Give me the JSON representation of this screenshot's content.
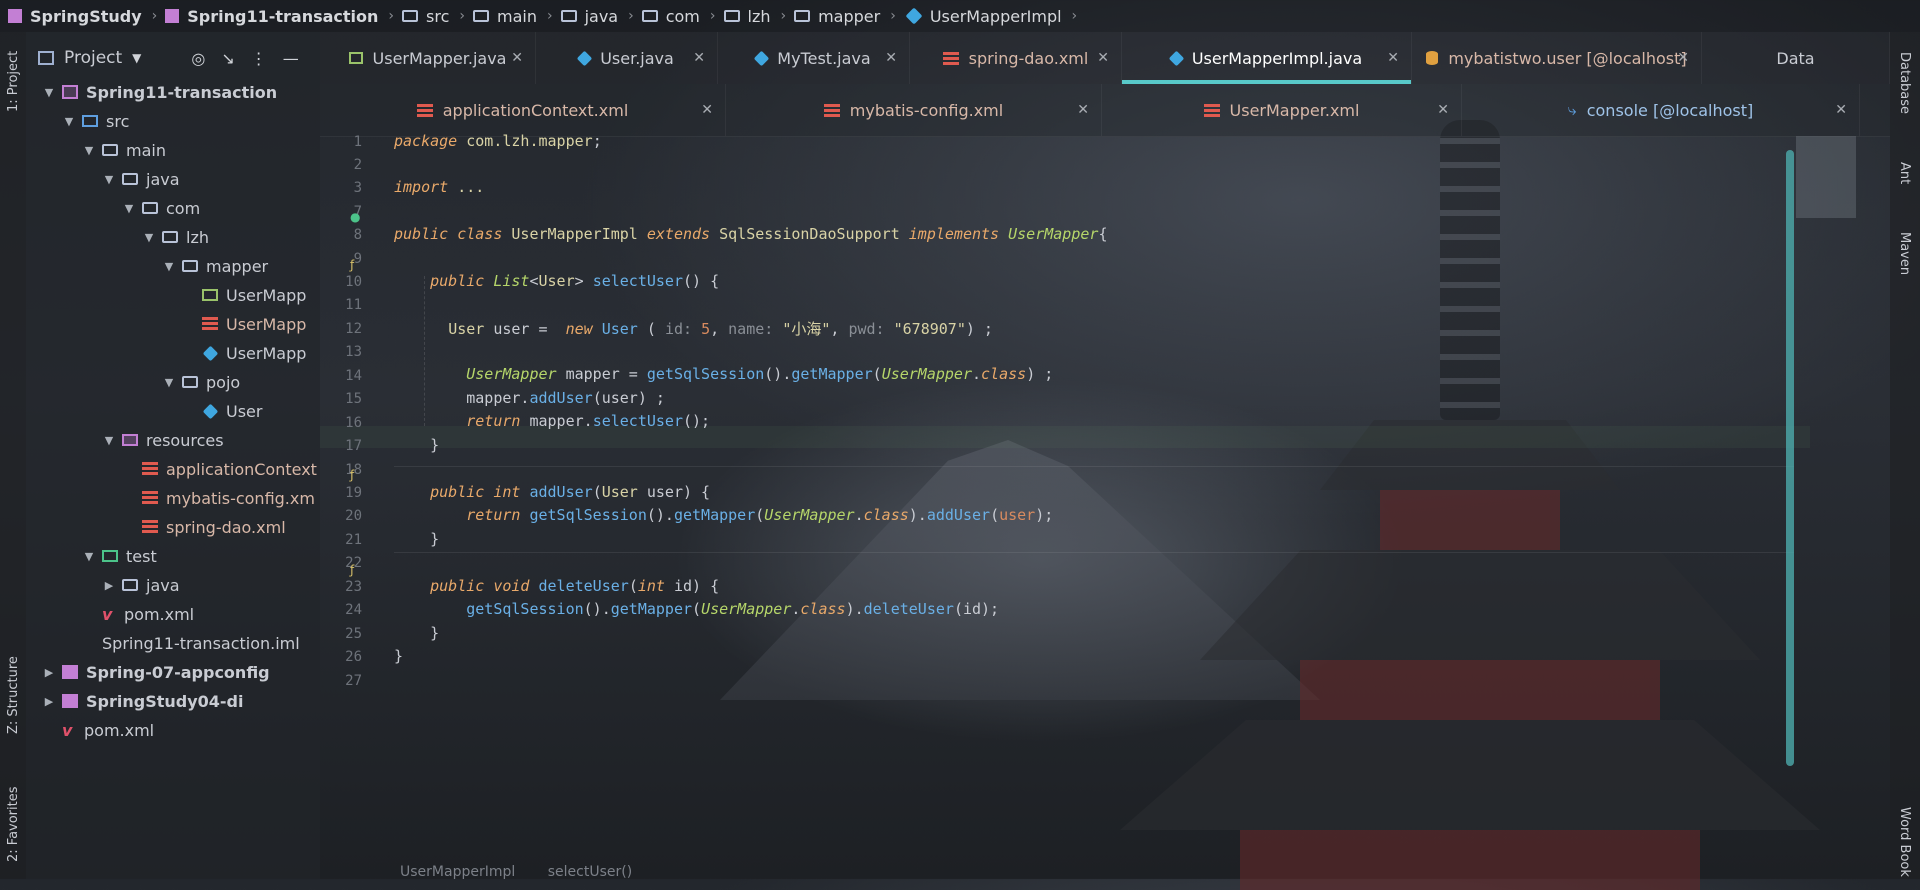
{
  "breadcrumb": {
    "items": [
      {
        "label": "SpringStudy",
        "icon": "module-icon",
        "bold": true
      },
      {
        "label": "Spring11-transaction",
        "icon": "module-icon",
        "bold": true
      },
      {
        "label": "src",
        "icon": "folder-icon"
      },
      {
        "label": "main",
        "icon": "folder-icon"
      },
      {
        "label": "java",
        "icon": "folder-icon"
      },
      {
        "label": "com",
        "icon": "folder-icon"
      },
      {
        "label": "lzh",
        "icon": "folder-icon"
      },
      {
        "label": "mapper",
        "icon": "folder-icon"
      },
      {
        "label": "UserMapperImpl",
        "icon": "class-icon"
      }
    ]
  },
  "left_strip": {
    "project": "1: Project",
    "structure": "Z: Structure",
    "favorites": "2: Favorites"
  },
  "right_strip": {
    "database": "Database",
    "ant": "Ant",
    "maven": "Maven",
    "word_book": "Word Book"
  },
  "project_panel": {
    "title": "Project",
    "tree": [
      {
        "label": "Spring11-transaction",
        "icon": "module",
        "arrow": "down",
        "bold": true
      },
      {
        "label": "src",
        "icon": "src",
        "arrow": "down"
      },
      {
        "label": "main",
        "icon": "folder",
        "arrow": "down"
      },
      {
        "label": "java",
        "icon": "folder",
        "arrow": "down"
      },
      {
        "label": "com",
        "icon": "folder",
        "arrow": "down"
      },
      {
        "label": "lzh",
        "icon": "folder",
        "arrow": "down"
      },
      {
        "label": "mapper",
        "icon": "folder",
        "arrow": "down"
      },
      {
        "label": "UserMapp",
        "icon": "iface"
      },
      {
        "label": "UserMapp",
        "icon": "xml"
      },
      {
        "label": "UserMapp",
        "icon": "cls"
      },
      {
        "label": "pojo",
        "icon": "folder",
        "arrow": "down"
      },
      {
        "label": "User",
        "icon": "cls"
      },
      {
        "label": "resources",
        "icon": "res",
        "arrow": "down"
      },
      {
        "label": "applicationContext",
        "icon": "xml"
      },
      {
        "label": "mybatis-config.xm",
        "icon": "xml"
      },
      {
        "label": "spring-dao.xml",
        "icon": "xml"
      },
      {
        "label": "test",
        "icon": "test",
        "arrow": "down"
      },
      {
        "label": "java",
        "icon": "folder",
        "arrow": "right"
      },
      {
        "label": "pom.xml",
        "icon": "maven"
      },
      {
        "label": "Spring11-transaction.iml",
        "icon": "iml"
      },
      {
        "label": "Spring-07-appconfig",
        "icon": "mod-solid",
        "arrow": "right",
        "bold": true
      },
      {
        "label": "SpringStudy04-di",
        "icon": "mod-solid",
        "arrow": "right",
        "bold": true
      },
      {
        "label": "pom.xml",
        "icon": "maven"
      }
    ]
  },
  "tabs_row1": [
    {
      "label": "UserMapper.java",
      "icon": "iface"
    },
    {
      "label": "User.java",
      "icon": "cls"
    },
    {
      "label": "MyTest.java",
      "icon": "cls"
    },
    {
      "label": "spring-dao.xml",
      "icon": "xml"
    },
    {
      "label": "UserMapperImpl.java",
      "icon": "cls",
      "active": true
    },
    {
      "label": "mybatistwo.user [@localhost]",
      "icon": "db"
    },
    {
      "label": "Data",
      "icon": "none"
    }
  ],
  "tabs_row2": [
    {
      "label": "applicationContext.xml",
      "icon": "xml"
    },
    {
      "label": "mybatis-config.xml",
      "icon": "xml"
    },
    {
      "label": "UserMapper.xml",
      "icon": "xml"
    },
    {
      "label": "console [@localhost]",
      "icon": "console"
    }
  ],
  "editor": {
    "line_numbers": [
      "1",
      "2",
      "3",
      "7",
      "8",
      "9",
      "10",
      "11",
      "12",
      "13",
      "14",
      "15",
      "16",
      "17",
      "18",
      "19",
      "20",
      "21",
      "22",
      "23",
      "24",
      "25",
      "26",
      "27"
    ]
  },
  "status_crumb": [
    "UserMapperImpl",
    "selectUser()"
  ],
  "colors": {
    "accent": "#58c9c9",
    "keyword": "#e9a96a",
    "type": "#b6d66a",
    "function": "#6ab0e6"
  }
}
